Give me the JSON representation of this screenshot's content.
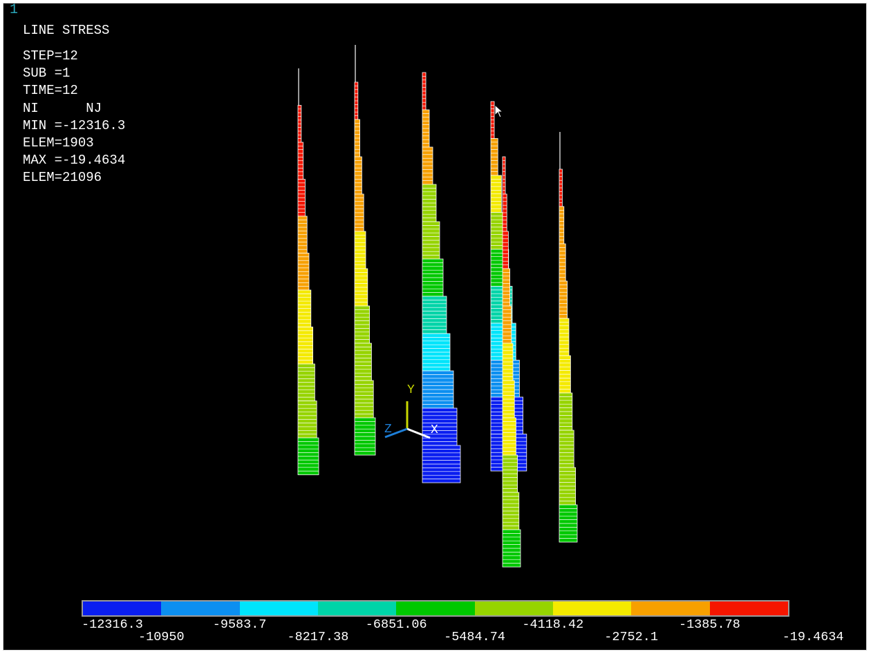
{
  "window_number": "1",
  "title": "LINE STRESS",
  "info_lines": [
    "STEP=12",
    "SUB =1",
    "TIME=12",
    "NI      NJ",
    "MIN =-12316.3",
    "ELEM=1903",
    "MAX =-19.4634",
    "ELEM=21096"
  ],
  "axis_triad": {
    "y": "Y",
    "x": "X",
    "z": "Z"
  },
  "legend": {
    "colors": [
      "#0a1ef0",
      "#0c8ff0",
      "#00e4fb",
      "#00d4a8",
      "#00c800",
      "#96d400",
      "#f4ea00",
      "#f7a000",
      "#f51600"
    ],
    "labels": [
      "-12316.3",
      "-10950",
      "-9583.7",
      "-8217.38",
      "-6851.06",
      "-5484.74",
      "-4118.42",
      "-2752.1",
      "-1385.78",
      "-19.4634"
    ]
  },
  "columns": [
    {
      "name": "column-1",
      "segments": [
        [
          0,
          null
        ],
        [
          3,
          "red"
        ],
        [
          4,
          "red"
        ],
        [
          5,
          "red"
        ],
        [
          6,
          "orange"
        ],
        [
          7,
          "orange"
        ],
        [
          8,
          "yellow"
        ],
        [
          9,
          "yellow"
        ],
        [
          10,
          "lime"
        ],
        [
          11,
          "lime"
        ],
        [
          12,
          "green"
        ]
      ]
    },
    {
      "name": "column-2",
      "segments": [
        [
          0,
          null
        ],
        [
          2,
          "red"
        ],
        [
          3,
          "orange"
        ],
        [
          4,
          "orange"
        ],
        [
          5,
          "orange"
        ],
        [
          6,
          "yellow"
        ],
        [
          7,
          "yellow"
        ],
        [
          8,
          "lime"
        ],
        [
          9,
          "lime"
        ],
        [
          10,
          "lime"
        ],
        [
          11,
          "green"
        ]
      ]
    },
    {
      "name": "column-3",
      "segments": [
        [
          2,
          "red"
        ],
        [
          3,
          "orange"
        ],
        [
          4,
          "orange"
        ],
        [
          5,
          "lime"
        ],
        [
          6,
          "lime"
        ],
        [
          7,
          "green"
        ],
        [
          8,
          "teal"
        ],
        [
          9,
          "cyan"
        ],
        [
          10,
          "azure"
        ],
        [
          11,
          "blue"
        ],
        [
          12,
          "blue"
        ]
      ]
    },
    {
      "name": "column-4",
      "segments": [
        [
          3,
          "red"
        ],
        [
          4,
          "orange"
        ],
        [
          5,
          "yellow"
        ],
        [
          6,
          "lime"
        ],
        [
          7,
          "green"
        ],
        [
          8,
          "teal"
        ],
        [
          9,
          "cyan"
        ],
        [
          10,
          "azure"
        ],
        [
          11,
          "blue"
        ],
        [
          12,
          "blue"
        ]
      ]
    },
    {
      "name": "column-5",
      "segments": [
        [
          4,
          "red"
        ],
        [
          5,
          "red"
        ],
        [
          6,
          "red"
        ],
        [
          7,
          "orange"
        ],
        [
          8,
          "orange"
        ],
        [
          9,
          "yellow"
        ],
        [
          10,
          "yellow"
        ],
        [
          11,
          "yellow"
        ],
        [
          12,
          "lime"
        ],
        [
          13,
          "lime"
        ],
        [
          14,
          "green"
        ]
      ]
    },
    {
      "name": "column-6",
      "segments": [
        [
          3,
          null
        ],
        [
          4,
          "red"
        ],
        [
          5,
          "orange"
        ],
        [
          6,
          "orange"
        ],
        [
          7,
          "orange"
        ],
        [
          8,
          "yellow"
        ],
        [
          9,
          "yellow"
        ],
        [
          10,
          "lime"
        ],
        [
          11,
          "lime"
        ],
        [
          12,
          "lime"
        ],
        [
          13,
          "green"
        ]
      ]
    }
  ]
}
